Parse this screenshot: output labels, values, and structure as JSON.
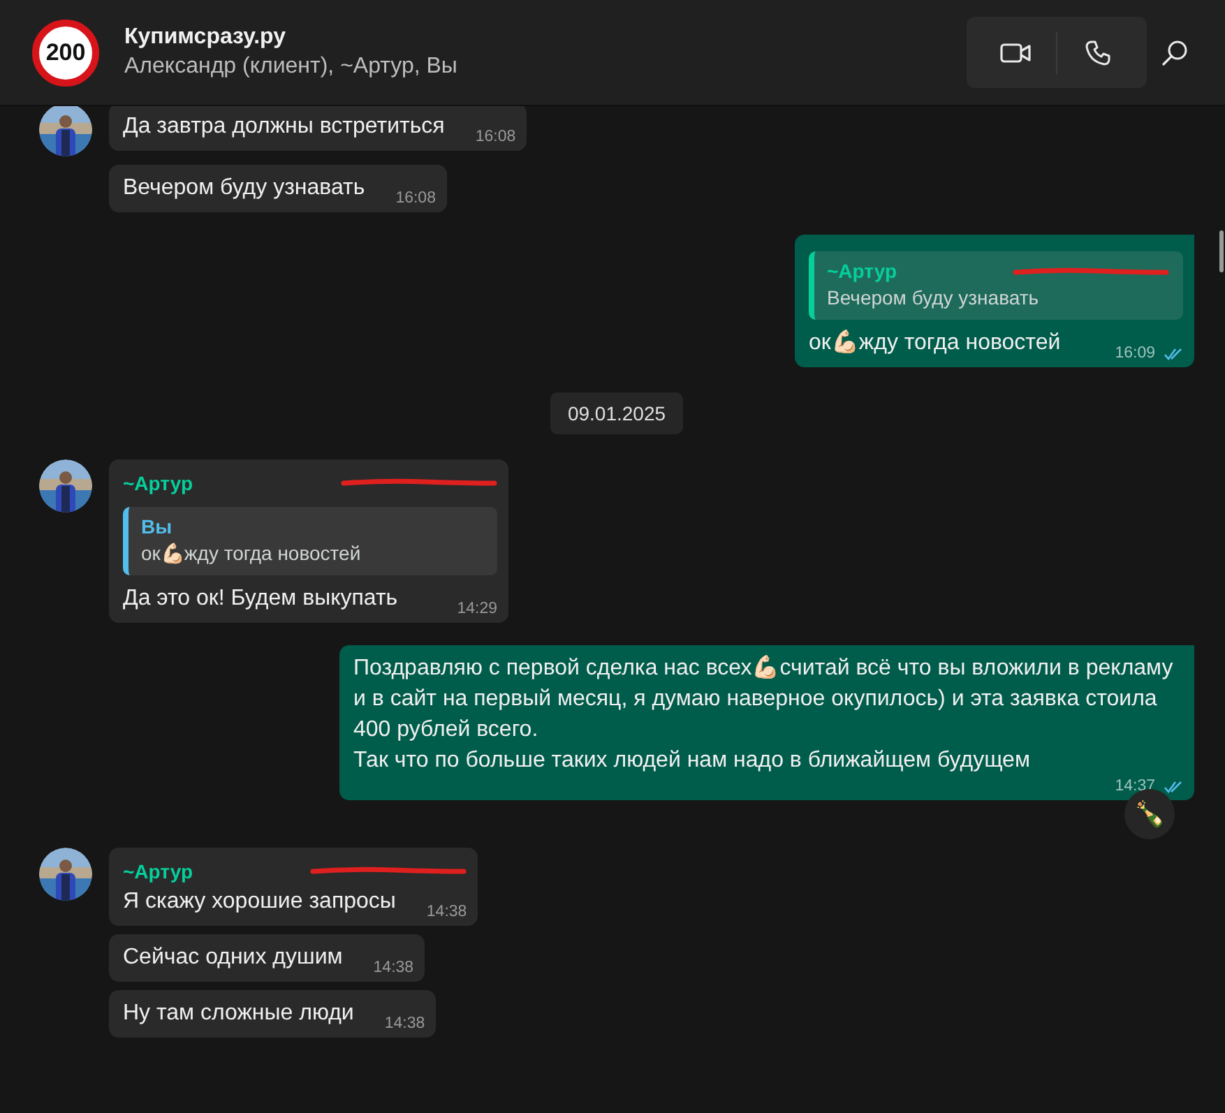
{
  "header": {
    "logo_text": "200",
    "title": "Купимсразу.ру",
    "subtitle": "Александр (клиент), ~Артур, Вы"
  },
  "messages": [
    {
      "kind": "incoming",
      "avatar": true,
      "text": "Да завтра должны встретиться",
      "time": "16:08"
    },
    {
      "kind": "incoming",
      "avatar": false,
      "text": "Вечером буду узнавать",
      "time": "16:08"
    },
    {
      "kind": "outgoing",
      "quote": {
        "author": "~Артур",
        "redacted": true,
        "text": "Вечером буду узнавать"
      },
      "text": "ок💪🏻жду тогда новостей",
      "time": "16:09",
      "read": true
    },
    {
      "kind": "date",
      "text": "09.01.2025"
    },
    {
      "kind": "incoming",
      "avatar": true,
      "sender": "~Артур",
      "redacted": true,
      "quote": {
        "author": "Вы",
        "text": "ок💪🏻жду тогда новостей"
      },
      "text": "Да это ок! Будем выкупать",
      "time": "14:29"
    },
    {
      "kind": "outgoing",
      "text": "Поздравляю с первой сделка нас всех💪🏻считай всё что вы вложили в рекламу и в сайт на первый месяц, я думаю наверное окупилось) и эта заявка стоила 400 рублей всего.\nТак что по больше таких людей нам надо в ближайщем будущем",
      "time": "14:37",
      "read": true,
      "reaction": "🍾"
    },
    {
      "kind": "incoming",
      "avatar": true,
      "sender": "~Артур",
      "redacted": true,
      "text": "Я скажу хорошие запросы",
      "time": "14:38"
    },
    {
      "kind": "incoming",
      "avatar": false,
      "text": "Сейчас одних душим",
      "time": "14:38"
    },
    {
      "kind": "incoming",
      "avatar": false,
      "text": "Ну там сложные люди",
      "time": "14:38"
    }
  ]
}
